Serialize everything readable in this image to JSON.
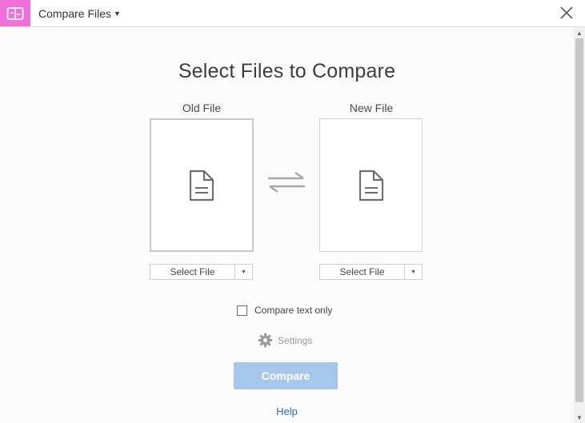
{
  "header": {
    "tool_title": "Compare Files",
    "tool_icon": "compare-files-icon",
    "close_icon": "close-icon"
  },
  "main": {
    "heading": "Select Files to Compare",
    "old_file": {
      "label": "Old File",
      "icon": "document-icon",
      "select_label": "Select File"
    },
    "new_file": {
      "label": "New File",
      "icon": "document-icon",
      "select_label": "Select File"
    },
    "swap_icon": "swap-arrows-icon",
    "compare_text_only": {
      "label": "Compare text only",
      "checked": false
    },
    "settings_label": "Settings",
    "compare_button": "Compare",
    "help_link": "Help"
  },
  "colors": {
    "accent_magenta": "#f06fd8",
    "compare_button_disabled": "#a7c7ea",
    "link_blue": "#2d6bbd"
  }
}
